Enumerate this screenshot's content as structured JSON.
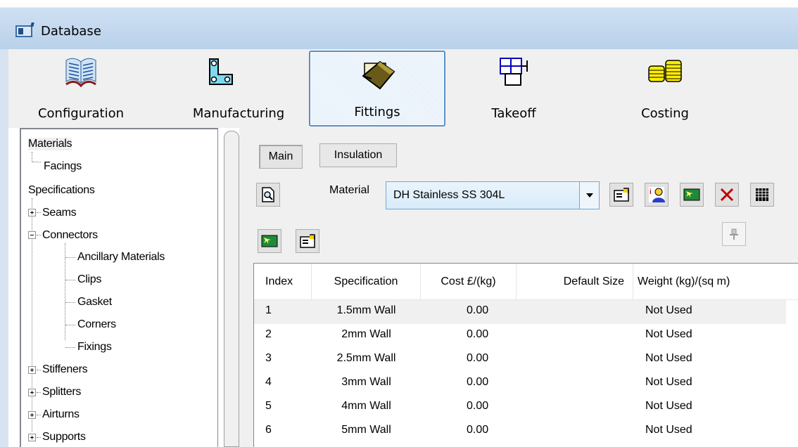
{
  "window": {
    "title": "Database"
  },
  "ribbon": {
    "buttons": [
      {
        "label": "Configuration",
        "icon": "book-icon"
      },
      {
        "label": "Manufacturing",
        "icon": "duct-elbow-icon"
      },
      {
        "label": "Fittings",
        "icon": "fitting-icon"
      },
      {
        "label": "Takeoff",
        "icon": "takeoff-icon"
      },
      {
        "label": "Costing",
        "icon": "coins-icon"
      }
    ],
    "active": "Fittings"
  },
  "tree": {
    "items": [
      {
        "label": "Materials"
      },
      {
        "label": "Facings"
      },
      {
        "label": "Specifications"
      },
      {
        "label": "Seams"
      },
      {
        "label": "Connectors"
      },
      {
        "label": "Ancillary Materials"
      },
      {
        "label": "Clips"
      },
      {
        "label": "Gasket"
      },
      {
        "label": "Corners"
      },
      {
        "label": "Fixings"
      },
      {
        "label": "Stiffeners"
      },
      {
        "label": "Splitters"
      },
      {
        "label": "Airturns"
      },
      {
        "label": "Supports"
      }
    ]
  },
  "tabs": {
    "main": "Main",
    "insulation": "Insulation"
  },
  "material": {
    "label": "Material",
    "value": "DH Stainless SS 304L"
  },
  "grid": {
    "columns": [
      "Index",
      "Specification",
      "Cost £/(kg)",
      "Default Size",
      "Weight (kg)/(sq m)"
    ],
    "rows": [
      [
        "1",
        "1.5mm Wall",
        "0.00",
        "",
        "Not Used"
      ],
      [
        "2",
        "2mm Wall",
        "0.00",
        "",
        "Not Used"
      ],
      [
        "3",
        "2.5mm Wall",
        "0.00",
        "",
        "Not Used"
      ],
      [
        "4",
        "3mm Wall",
        "0.00",
        "",
        "Not Used"
      ],
      [
        "5",
        "4mm Wall",
        "0.00",
        "",
        "Not Used"
      ],
      [
        "6",
        "5mm Wall",
        "0.00",
        "",
        "Not Used"
      ]
    ]
  }
}
